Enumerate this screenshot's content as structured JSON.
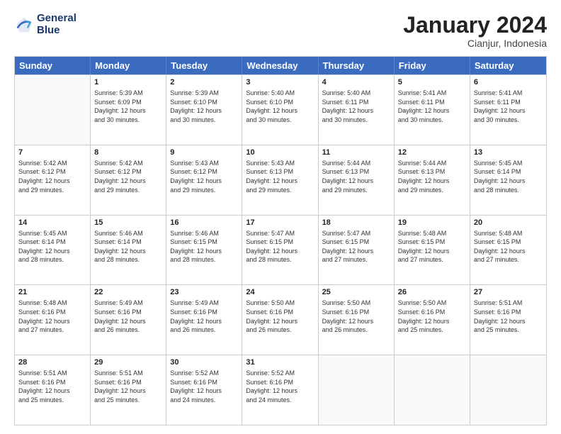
{
  "header": {
    "logo_line1": "General",
    "logo_line2": "Blue",
    "month_title": "January 2024",
    "location": "Cianjur, Indonesia"
  },
  "days_of_week": [
    "Sunday",
    "Monday",
    "Tuesday",
    "Wednesday",
    "Thursday",
    "Friday",
    "Saturday"
  ],
  "weeks": [
    [
      {
        "day": "",
        "info": ""
      },
      {
        "day": "1",
        "info": "Sunrise: 5:39 AM\nSunset: 6:09 PM\nDaylight: 12 hours\nand 30 minutes."
      },
      {
        "day": "2",
        "info": "Sunrise: 5:39 AM\nSunset: 6:10 PM\nDaylight: 12 hours\nand 30 minutes."
      },
      {
        "day": "3",
        "info": "Sunrise: 5:40 AM\nSunset: 6:10 PM\nDaylight: 12 hours\nand 30 minutes."
      },
      {
        "day": "4",
        "info": "Sunrise: 5:40 AM\nSunset: 6:11 PM\nDaylight: 12 hours\nand 30 minutes."
      },
      {
        "day": "5",
        "info": "Sunrise: 5:41 AM\nSunset: 6:11 PM\nDaylight: 12 hours\nand 30 minutes."
      },
      {
        "day": "6",
        "info": "Sunrise: 5:41 AM\nSunset: 6:11 PM\nDaylight: 12 hours\nand 30 minutes."
      }
    ],
    [
      {
        "day": "7",
        "info": "Sunrise: 5:42 AM\nSunset: 6:12 PM\nDaylight: 12 hours\nand 29 minutes."
      },
      {
        "day": "8",
        "info": "Sunrise: 5:42 AM\nSunset: 6:12 PM\nDaylight: 12 hours\nand 29 minutes."
      },
      {
        "day": "9",
        "info": "Sunrise: 5:43 AM\nSunset: 6:12 PM\nDaylight: 12 hours\nand 29 minutes."
      },
      {
        "day": "10",
        "info": "Sunrise: 5:43 AM\nSunset: 6:13 PM\nDaylight: 12 hours\nand 29 minutes."
      },
      {
        "day": "11",
        "info": "Sunrise: 5:44 AM\nSunset: 6:13 PM\nDaylight: 12 hours\nand 29 minutes."
      },
      {
        "day": "12",
        "info": "Sunrise: 5:44 AM\nSunset: 6:13 PM\nDaylight: 12 hours\nand 29 minutes."
      },
      {
        "day": "13",
        "info": "Sunrise: 5:45 AM\nSunset: 6:14 PM\nDaylight: 12 hours\nand 28 minutes."
      }
    ],
    [
      {
        "day": "14",
        "info": "Sunrise: 5:45 AM\nSunset: 6:14 PM\nDaylight: 12 hours\nand 28 minutes."
      },
      {
        "day": "15",
        "info": "Sunrise: 5:46 AM\nSunset: 6:14 PM\nDaylight: 12 hours\nand 28 minutes."
      },
      {
        "day": "16",
        "info": "Sunrise: 5:46 AM\nSunset: 6:15 PM\nDaylight: 12 hours\nand 28 minutes."
      },
      {
        "day": "17",
        "info": "Sunrise: 5:47 AM\nSunset: 6:15 PM\nDaylight: 12 hours\nand 28 minutes."
      },
      {
        "day": "18",
        "info": "Sunrise: 5:47 AM\nSunset: 6:15 PM\nDaylight: 12 hours\nand 27 minutes."
      },
      {
        "day": "19",
        "info": "Sunrise: 5:48 AM\nSunset: 6:15 PM\nDaylight: 12 hours\nand 27 minutes."
      },
      {
        "day": "20",
        "info": "Sunrise: 5:48 AM\nSunset: 6:15 PM\nDaylight: 12 hours\nand 27 minutes."
      }
    ],
    [
      {
        "day": "21",
        "info": "Sunrise: 5:48 AM\nSunset: 6:16 PM\nDaylight: 12 hours\nand 27 minutes."
      },
      {
        "day": "22",
        "info": "Sunrise: 5:49 AM\nSunset: 6:16 PM\nDaylight: 12 hours\nand 26 minutes."
      },
      {
        "day": "23",
        "info": "Sunrise: 5:49 AM\nSunset: 6:16 PM\nDaylight: 12 hours\nand 26 minutes."
      },
      {
        "day": "24",
        "info": "Sunrise: 5:50 AM\nSunset: 6:16 PM\nDaylight: 12 hours\nand 26 minutes."
      },
      {
        "day": "25",
        "info": "Sunrise: 5:50 AM\nSunset: 6:16 PM\nDaylight: 12 hours\nand 26 minutes."
      },
      {
        "day": "26",
        "info": "Sunrise: 5:50 AM\nSunset: 6:16 PM\nDaylight: 12 hours\nand 25 minutes."
      },
      {
        "day": "27",
        "info": "Sunrise: 5:51 AM\nSunset: 6:16 PM\nDaylight: 12 hours\nand 25 minutes."
      }
    ],
    [
      {
        "day": "28",
        "info": "Sunrise: 5:51 AM\nSunset: 6:16 PM\nDaylight: 12 hours\nand 25 minutes."
      },
      {
        "day": "29",
        "info": "Sunrise: 5:51 AM\nSunset: 6:16 PM\nDaylight: 12 hours\nand 25 minutes."
      },
      {
        "day": "30",
        "info": "Sunrise: 5:52 AM\nSunset: 6:16 PM\nDaylight: 12 hours\nand 24 minutes."
      },
      {
        "day": "31",
        "info": "Sunrise: 5:52 AM\nSunset: 6:16 PM\nDaylight: 12 hours\nand 24 minutes."
      },
      {
        "day": "",
        "info": ""
      },
      {
        "day": "",
        "info": ""
      },
      {
        "day": "",
        "info": ""
      }
    ]
  ]
}
